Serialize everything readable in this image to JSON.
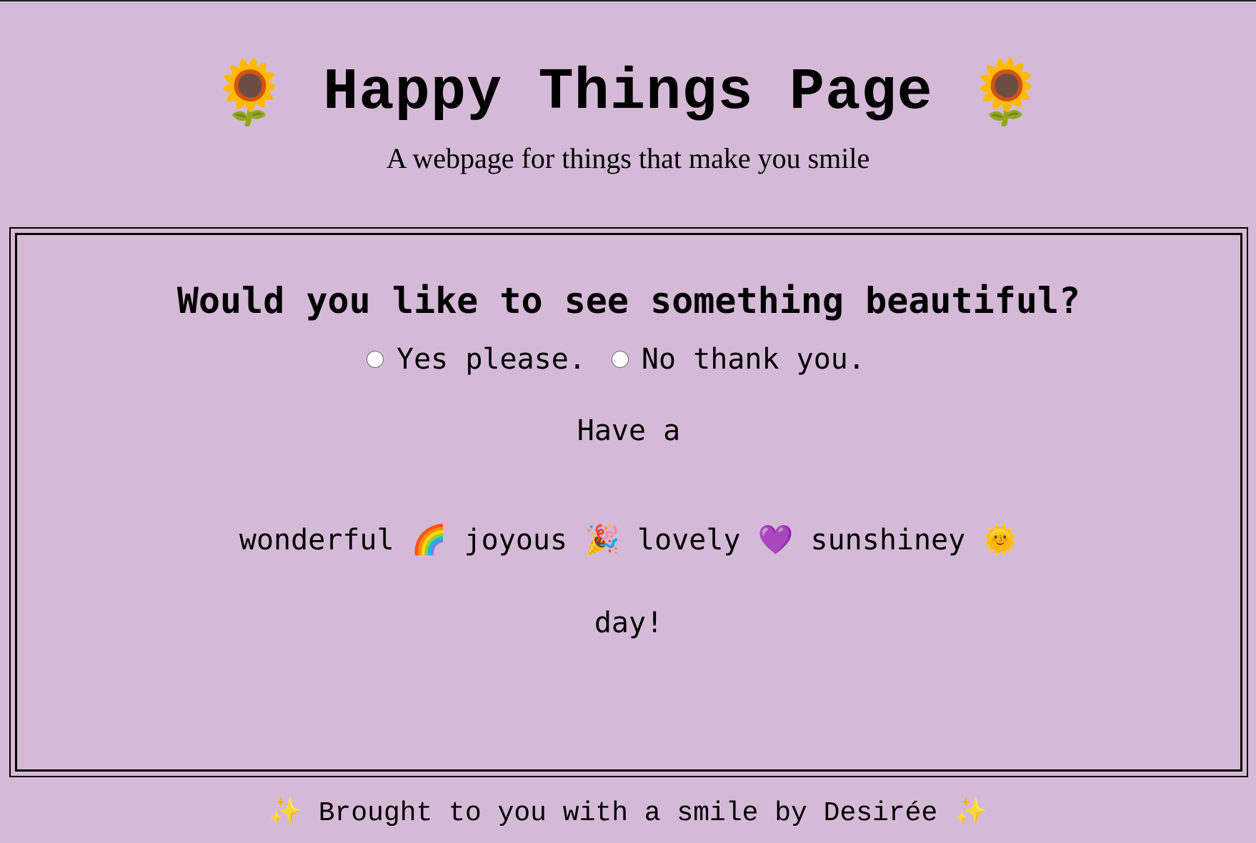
{
  "header": {
    "left_icon": "🌻",
    "title": "Happy Things Page",
    "right_icon": "🌻",
    "subtitle": "A webpage for things that make you smile"
  },
  "main": {
    "question": "Would you like to see something beautiful?",
    "options": [
      {
        "label": "Yes please."
      },
      {
        "label": "No thank you."
      }
    ],
    "line1": "Have a",
    "adjectives": "wonderful 🌈 joyous 🎉 lovely 💜 sunshiney 🌞",
    "line3": "day!"
  },
  "footer": {
    "text": "✨ Brought to you with a smile by Desirée ✨"
  },
  "colors": {
    "background": "#d5bad7"
  }
}
